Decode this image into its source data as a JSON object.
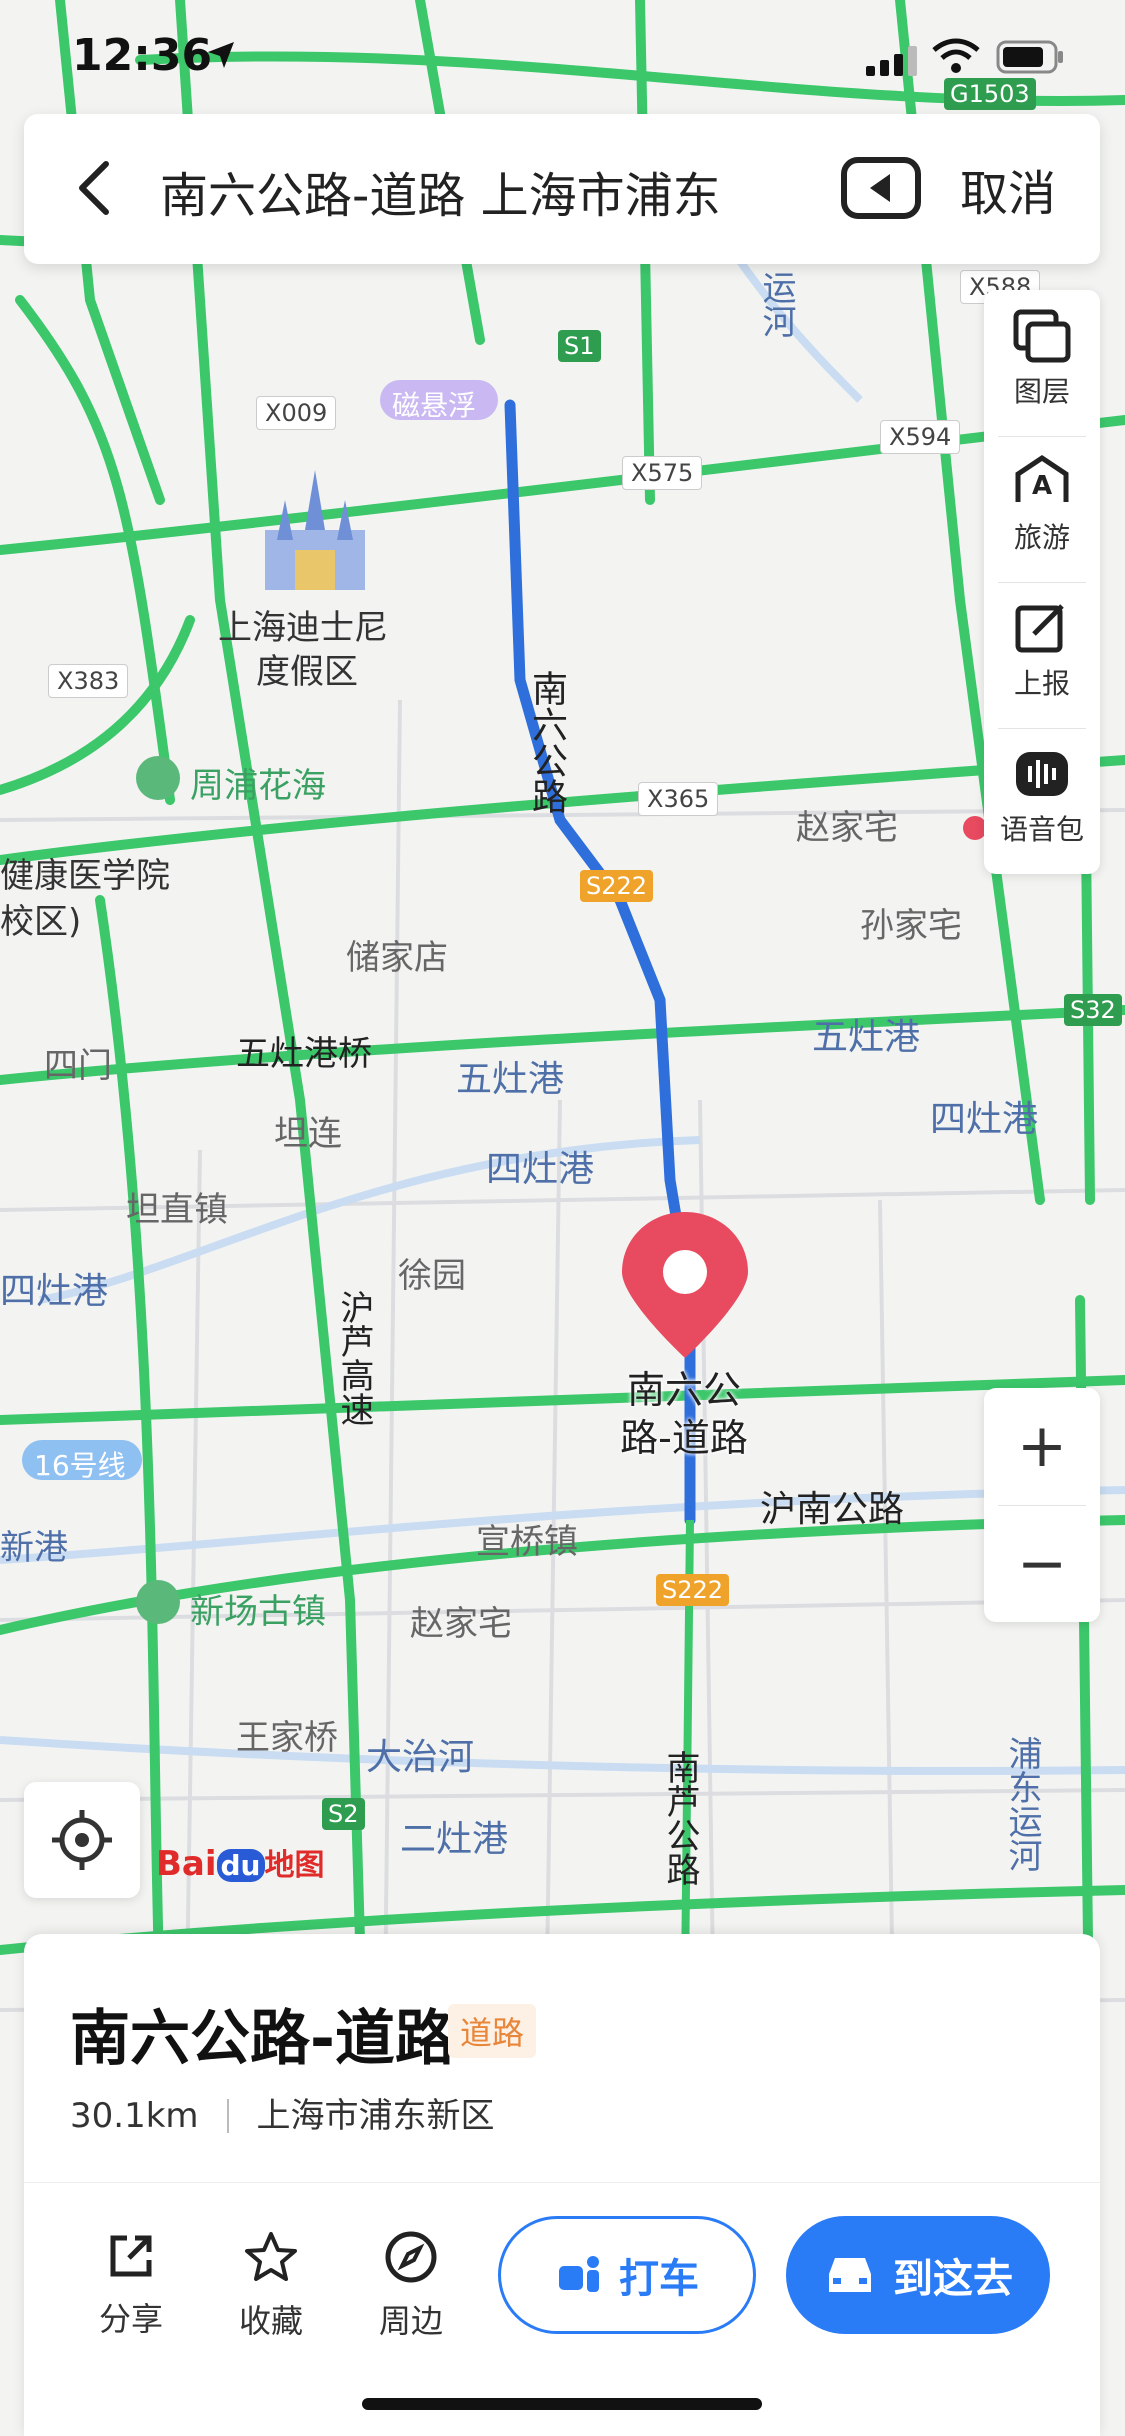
{
  "status_bar": {
    "time": "12:36"
  },
  "search_bar": {
    "query": "南六公路-道路 上海市浦东",
    "cancel_label": "取消"
  },
  "right_tools": [
    {
      "label": "图层",
      "icon": "layers-icon"
    },
    {
      "label": "旅游",
      "icon": "travel-icon"
    },
    {
      "label": "上报",
      "icon": "report-icon"
    },
    {
      "label": "语音包",
      "icon": "voice-pack-icon"
    }
  ],
  "zoom": {
    "in": "+",
    "out": "−"
  },
  "map": {
    "route_label": "南六公路",
    "pin_label": "南六公路-道路",
    "area_labels": [
      "上海迪士尼度假区",
      "周浦花海",
      "健康医学院",
      "校区)",
      "储家店",
      "赵家宅",
      "孙家宅",
      "四门",
      "五灶港桥",
      "坦连",
      "坦直镇",
      "徐园",
      "宣桥镇",
      "赵家宅",
      "王家桥",
      "新场古镇",
      "大治河",
      "二灶港",
      "五灶港",
      "四灶港",
      "沪南公路",
      "南芦公路",
      "沪芦高速",
      "浦东运河",
      "16号线",
      "磁悬浮",
      "新港",
      "运河"
    ],
    "road_shields": [
      "G1503",
      "S1",
      "X009",
      "X575",
      "X594",
      "X588",
      "X383",
      "X365",
      "S222",
      "S32",
      "S2"
    ],
    "poi_shanghai_disney_line1": "上海迪士尼",
    "poi_shanghai_disney_line2": "度假区",
    "logo_text": "Bai",
    "logo_du": "du",
    "logo_map": "地图"
  },
  "place_card": {
    "title": "南六公路-道路",
    "tag": "道路",
    "distance": "30.1km",
    "location": "上海市浦东新区",
    "actions": [
      {
        "label": "分享",
        "icon": "share-icon"
      },
      {
        "label": "收藏",
        "icon": "star-icon"
      },
      {
        "label": "周边",
        "icon": "compass-icon"
      }
    ],
    "taxi_label": "打车",
    "navigate_label": "到这去"
  },
  "colors": {
    "accent": "#2a7bf6",
    "route": "#2f6fdc",
    "road_green": "#3cc76b",
    "pin": "#e84a5f"
  }
}
